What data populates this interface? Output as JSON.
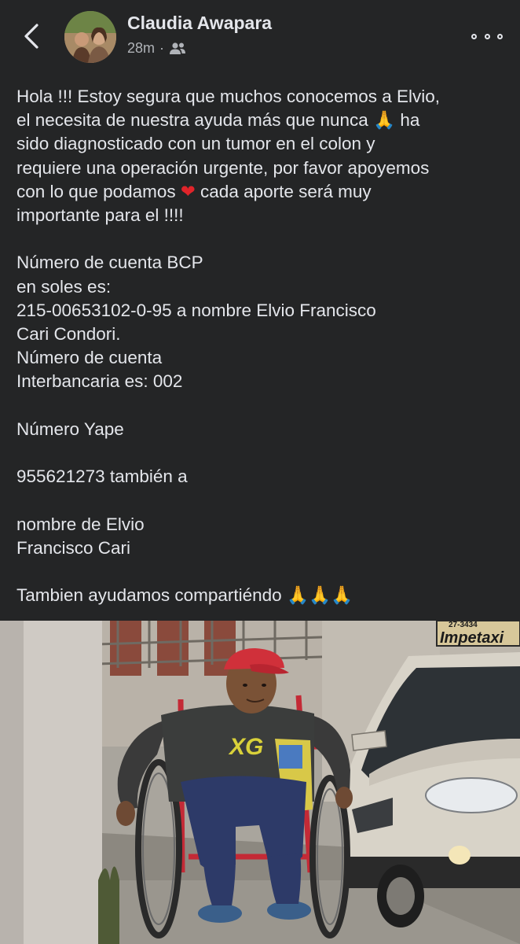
{
  "header": {
    "back_icon": "chevron-left-icon",
    "author_name": "Claudia Awapara",
    "time": "28m",
    "audience_icon": "friends-icon",
    "more_icon": "more-options-icon"
  },
  "post": {
    "lines": {
      "l1": "Hola !!! Estoy segura que muchos conocemos a Elvio,",
      "l2a": "el necesita de nuestra ayuda más que nunca",
      "l2b": "ha",
      "l3": "sido diagnosticado con un tumor en el colon y",
      "l4": "requiere una operación urgente, por favor apoyemos",
      "l5a": "con lo que podamos",
      "l5b": "cada aporte será muy",
      "l6": "importante para el !!!!",
      "l7": "Número de cuenta BCP",
      "l8": "en soles es:",
      "l9": "215-00653102-0-95 a nombre Elvio Francisco",
      "l10": "Cari Condori.",
      "l11": "Número de cuenta",
      "l12": "Interbancaria es: 002",
      "l13": "Número Yape",
      "l14": "955621273 también a",
      "l15": "nombre de Elvio",
      "l16": "Francisco Cari",
      "l17": "Tambien ayudamos compartiéndo"
    },
    "emojis": {
      "pray": "🙏",
      "heart": "❤",
      "pray_triple": "🙏🙏🙏"
    }
  },
  "photo": {
    "sign_text": "Impetaxi",
    "phone_text": "27-3434",
    "cap_text": "XG",
    "colors": {
      "background": "#242526",
      "text": "#e4e6eb",
      "secondary": "#b0b3b8"
    }
  }
}
